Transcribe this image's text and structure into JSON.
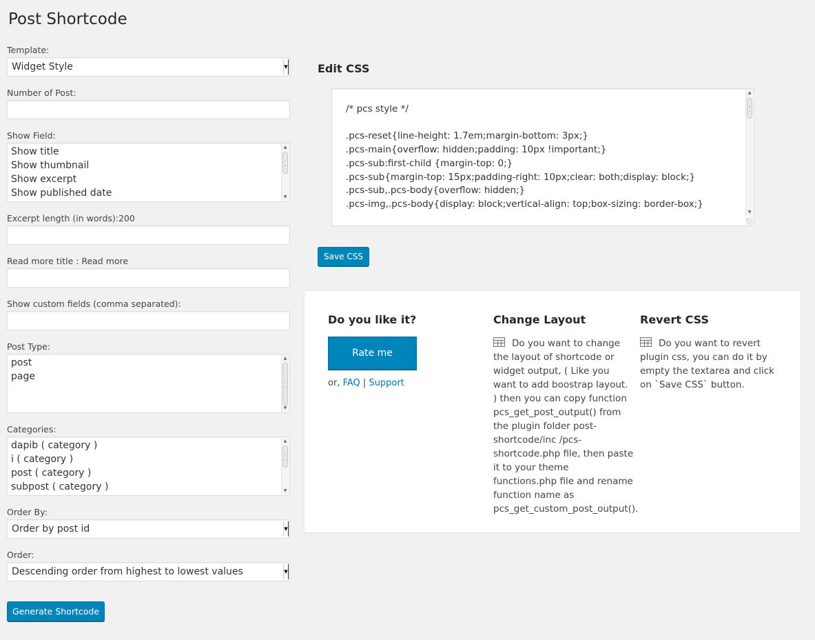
{
  "page": {
    "title": "Post Shortcode"
  },
  "form": {
    "template": {
      "label": "Template:",
      "value": "Widget Style"
    },
    "number_of_post": {
      "label": "Number of Post:",
      "value": ""
    },
    "show_field": {
      "label": "Show Field:",
      "options": [
        "Show title",
        "Show thumbnail",
        "Show excerpt",
        "Show published date"
      ]
    },
    "excerpt_length": {
      "label": "Excerpt length (in words):200",
      "value": ""
    },
    "read_more_title": {
      "label": "Read more title : Read more",
      "value": ""
    },
    "custom_fields": {
      "label": "Show custom fields (comma separated):",
      "value": ""
    },
    "post_type": {
      "label": "Post Type:",
      "options": [
        "post",
        "page"
      ]
    },
    "categories": {
      "label": "Categories:",
      "options": [
        "dapib ( category )",
        "i ( category )",
        "post ( category )",
        "subpost ( category )"
      ]
    },
    "order_by": {
      "label": "Order By:",
      "value": "Order by post id"
    },
    "order": {
      "label": "Order:",
      "value": "Descending order from highest to lowest values"
    },
    "generate_button": "Generate Shortcode"
  },
  "css_editor": {
    "title": "Edit CSS",
    "content": "/* pcs style */\n\n.pcs-reset{line-height: 1.7em;margin-bottom: 3px;}\n.pcs-main{overflow: hidden;padding: 10px !important;}\n.pcs-sub:first-child {margin-top: 0;}\n.pcs-sub{margin-top: 15px;padding-right: 10px;clear: both;display: block;}\n.pcs-sub,.pcs-body{overflow: hidden;}\n.pcs-img,.pcs-body{display: block;vertical-align: top;box-sizing: border-box;}",
    "save_button": "Save CSS"
  },
  "info": {
    "like": {
      "title": "Do you like it?",
      "rate_button": "Rate me",
      "or_text": "or,",
      "faq_link": "FAQ",
      "separator": "|",
      "support_link": "Support"
    },
    "layout": {
      "title": "Change Layout",
      "icon": "table-icon",
      "text": "Do you want to change the layout of shortcode or widget output, ( Like you want to add boostrap layout. ) then you can copy function pcs_get_post_output() from the plugin folder post-shortcode/inc /pcs-shortcode.php file, then paste it to your theme functions.php file and rename function name as pcs_get_custom_post_output()."
    },
    "revert": {
      "title": "Revert CSS",
      "icon": "table-icon",
      "text": "Do you want to revert plugin css, you can do it by empty the textarea and click on `Save CSS` button."
    }
  }
}
